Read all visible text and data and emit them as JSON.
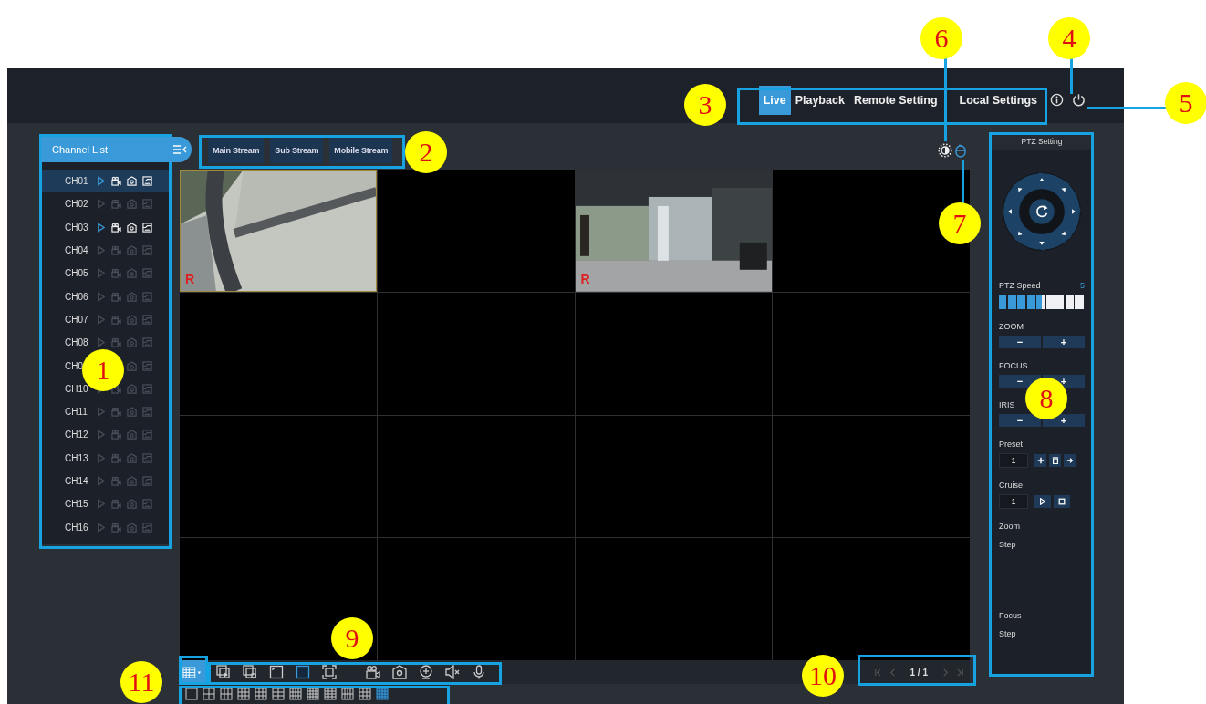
{
  "top_bar": {
    "tabs": [
      {
        "label": "Live",
        "selected": true
      },
      {
        "label": "Playback",
        "selected": false
      },
      {
        "label": "Remote Setting",
        "selected": false
      },
      {
        "label": "Local Settings",
        "selected": false
      }
    ]
  },
  "channel_list": {
    "title": "Channel List",
    "channels": [
      {
        "name": "CH01",
        "selected": true,
        "active": true
      },
      {
        "name": "CH02",
        "selected": false,
        "active": false
      },
      {
        "name": "CH03",
        "selected": false,
        "active": true
      },
      {
        "name": "CH04",
        "selected": false,
        "active": false
      },
      {
        "name": "CH05",
        "selected": false,
        "active": false
      },
      {
        "name": "CH06",
        "selected": false,
        "active": false
      },
      {
        "name": "CH07",
        "selected": false,
        "active": false
      },
      {
        "name": "CH08",
        "selected": false,
        "active": false
      },
      {
        "name": "CH0",
        "selected": false,
        "active": false
      },
      {
        "name": "CH10",
        "selected": false,
        "active": false
      },
      {
        "name": "CH11",
        "selected": false,
        "active": false
      },
      {
        "name": "CH12",
        "selected": false,
        "active": false
      },
      {
        "name": "CH13",
        "selected": false,
        "active": false
      },
      {
        "name": "CH14",
        "selected": false,
        "active": false
      },
      {
        "name": "CH15",
        "selected": false,
        "active": false
      },
      {
        "name": "CH16",
        "selected": false,
        "active": false
      }
    ]
  },
  "streams": [
    {
      "label": "Main Stream"
    },
    {
      "label": "Sub Stream"
    },
    {
      "label": "Mobile Stream"
    }
  ],
  "video_grid": {
    "cells": [
      {
        "kind": "picture",
        "selected": true,
        "mark": "R"
      },
      {
        "kind": "empty",
        "selected": false
      },
      {
        "kind": "picture",
        "selected": false,
        "mark": "R"
      },
      {
        "kind": "empty",
        "selected": false
      },
      {
        "kind": "empty",
        "selected": false
      },
      {
        "kind": "empty",
        "selected": false
      },
      {
        "kind": "empty",
        "selected": false
      },
      {
        "kind": "empty",
        "selected": false
      },
      {
        "kind": "empty",
        "selected": false
      },
      {
        "kind": "empty",
        "selected": false
      },
      {
        "kind": "empty",
        "selected": false
      },
      {
        "kind": "empty",
        "selected": false
      },
      {
        "kind": "empty",
        "selected": false
      },
      {
        "kind": "empty",
        "selected": false
      },
      {
        "kind": "empty",
        "selected": false
      },
      {
        "kind": "empty",
        "selected": false
      }
    ]
  },
  "layouts": [
    {
      "selected": false
    },
    {
      "selected": false
    },
    {
      "selected": false
    },
    {
      "selected": false
    },
    {
      "selected": false
    },
    {
      "selected": false
    },
    {
      "selected": false
    },
    {
      "selected": false
    },
    {
      "selected": false
    },
    {
      "selected": false
    },
    {
      "selected": false
    },
    {
      "selected": true
    }
  ],
  "pager": {
    "text": "1 / 1"
  },
  "ptz": {
    "title": "PTZ Setting",
    "speed": {
      "label": "PTZ Speed",
      "reading": "5",
      "level": 0.5
    },
    "controls": [
      {
        "label": "ZOOM",
        "buttons": [
          "−",
          "+"
        ]
      },
      {
        "label": "FOCUS",
        "buttons": [
          "−",
          "+"
        ]
      },
      {
        "label": "IRIS",
        "buttons": [
          "−",
          "+"
        ]
      }
    ],
    "preset": {
      "label": "Preset",
      "value": "1"
    },
    "cruise": {
      "label": "Cruise",
      "value": "1"
    },
    "zoom_step": {
      "label": "Zoom",
      "sublabel": "Step"
    },
    "focus_step": {
      "label": "Focus",
      "sublabel": "Step"
    }
  },
  "callouts": [
    "1",
    "2",
    "3",
    "4",
    "5",
    "6",
    "7",
    "8",
    "9",
    "10",
    "11"
  ]
}
